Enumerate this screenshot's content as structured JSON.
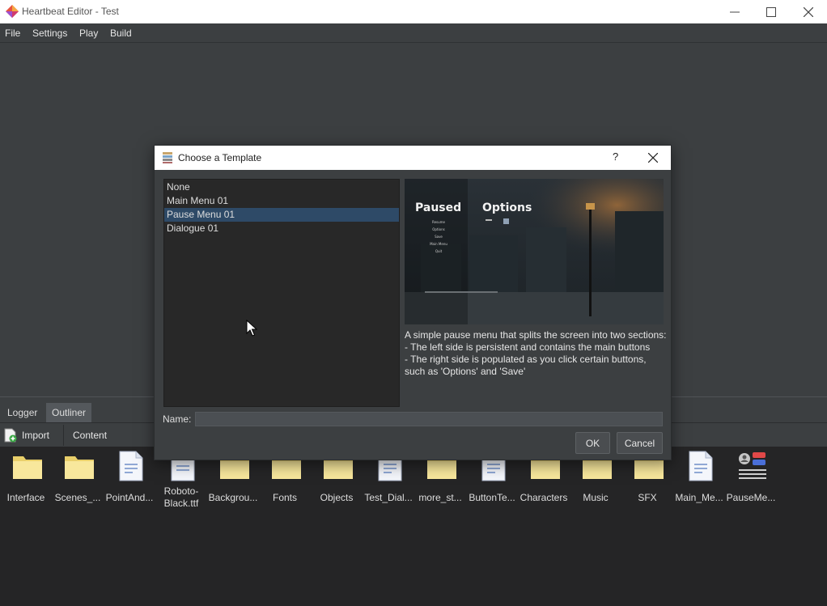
{
  "window": {
    "title": "Heartbeat Editor - Test"
  },
  "menu": [
    "File",
    "Settings",
    "Play",
    "Build"
  ],
  "dock": {
    "tabs": [
      "Logger",
      "Outliner"
    ],
    "active_tab": "Outliner",
    "toolbar": {
      "import_label": "Import",
      "content_label": "Content"
    },
    "assets": [
      {
        "label": "Interface",
        "type": "folder-icon"
      },
      {
        "label": "Scenes_...",
        "type": "folder-icon"
      },
      {
        "label": "PointAnd...",
        "type": "file-icon"
      },
      {
        "label": "Roboto-Black.ttf",
        "type": "font-file-icon"
      },
      {
        "label": "Backgrou...",
        "type": "folder-icon"
      },
      {
        "label": "Fonts",
        "type": "folder-icon"
      },
      {
        "label": "Objects",
        "type": "folder-icon"
      },
      {
        "label": "Test_Dial...",
        "type": "file-icon"
      },
      {
        "label": "more_st...",
        "type": "folder-icon"
      },
      {
        "label": "ButtonTe...",
        "type": "file-icon"
      },
      {
        "label": "Characters",
        "type": "folder-icon"
      },
      {
        "label": "Music",
        "type": "folder-icon"
      },
      {
        "label": "SFX",
        "type": "folder-icon"
      },
      {
        "label": "Main_Me...",
        "type": "file-icon"
      },
      {
        "label": "PauseMe...",
        "type": "ui-template-icon"
      }
    ]
  },
  "dialog": {
    "title": "Choose a Template",
    "help_label": "?",
    "templates": [
      "None",
      "Main Menu 01",
      "Pause Menu 01",
      "Dialogue 01"
    ],
    "selected_template": "Pause Menu 01",
    "preview": {
      "left_heading": "Paused",
      "right_heading": "Options",
      "menu_items": [
        "Resume",
        "Options",
        "Save",
        "Main Menu",
        "Quit"
      ]
    },
    "description": [
      "A simple pause menu that splits the screen into two sections:",
      "- The left side is persistent and contains the main buttons",
      "- The right side is populated as you click certain buttons, such as 'Options' and 'Save'"
    ],
    "name_label": "Name:",
    "name_value": "",
    "ok_label": "OK",
    "cancel_label": "Cancel"
  },
  "colors": {
    "background": "#3c3f41",
    "asset_panel": "#252526",
    "selection": "#2e4a67",
    "folder": "#f5e08a"
  }
}
